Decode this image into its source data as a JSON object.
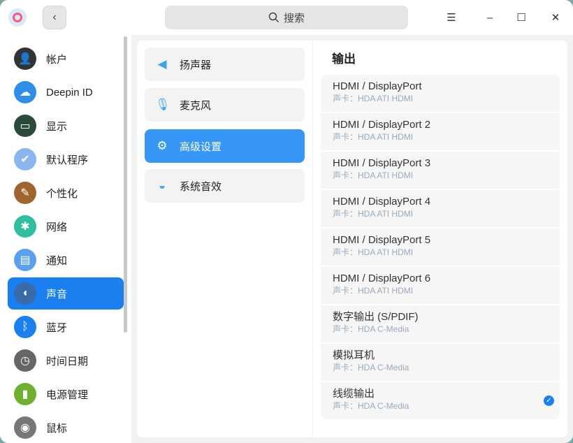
{
  "titlebar": {
    "back": "‹",
    "search_placeholder": "搜索",
    "menu": "☰",
    "minimize": "–",
    "maximize": "☐",
    "close": "✕"
  },
  "sidebar": {
    "items": [
      {
        "label": "帐户",
        "color": "#333333",
        "glyph": "👤"
      },
      {
        "label": "Deepin ID",
        "color": "#2f8fe8",
        "glyph": "☁"
      },
      {
        "label": "显示",
        "color": "#2a4a3a",
        "glyph": "▭"
      },
      {
        "label": "默认程序",
        "color": "#8ab6f0",
        "glyph": "✔"
      },
      {
        "label": "个性化",
        "color": "#a0642e",
        "glyph": "✎"
      },
      {
        "label": "网络",
        "color": "#2fbfa0",
        "glyph": "✱"
      },
      {
        "label": "通知",
        "color": "#5aa0f0",
        "glyph": "▤"
      },
      {
        "label": "声音",
        "color": "#3a6aa8",
        "glyph": "◖"
      },
      {
        "label": "蓝牙",
        "color": "#1a80f0",
        "glyph": "ᛒ"
      },
      {
        "label": "时间日期",
        "color": "#666666",
        "glyph": "◷"
      },
      {
        "label": "电源管理",
        "color": "#70b030",
        "glyph": "▮"
      },
      {
        "label": "鼠标",
        "color": "#777777",
        "glyph": "◉"
      }
    ],
    "selected": 7
  },
  "middle": {
    "items": [
      {
        "label": "扬声器",
        "glyph": "◀"
      },
      {
        "label": "麦克风",
        "glyph": "🎙"
      },
      {
        "label": "高级设置",
        "glyph": "⚙"
      },
      {
        "label": "系统音效",
        "glyph": "◒"
      }
    ],
    "selected": 2
  },
  "output": {
    "title": "输出",
    "items": [
      {
        "name": "HDMI / DisplayPort",
        "card": "声卡：HDA ATI HDMI"
      },
      {
        "name": "HDMI / DisplayPort 2",
        "card": "声卡：HDA ATI HDMI"
      },
      {
        "name": "HDMI / DisplayPort 3",
        "card": "声卡：HDA ATI HDMI"
      },
      {
        "name": "HDMI / DisplayPort 4",
        "card": "声卡：HDA ATI HDMI"
      },
      {
        "name": "HDMI / DisplayPort 5",
        "card": "声卡：HDA ATI HDMI"
      },
      {
        "name": "HDMI / DisplayPort 6",
        "card": "声卡：HDA ATI HDMI"
      },
      {
        "name": "数字输出 (S/PDIF)",
        "card": "声卡：HDA C-Media"
      },
      {
        "name": "模拟耳机",
        "card": "声卡：HDA C-Media"
      },
      {
        "name": "线缆输出",
        "card": "声卡：HDA C-Media"
      }
    ],
    "checked": 8,
    "check_glyph": "✓"
  }
}
